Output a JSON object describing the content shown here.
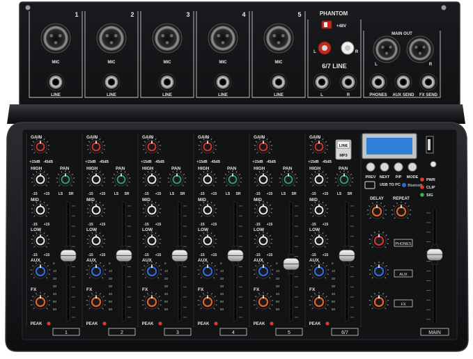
{
  "device": {
    "top_panel": {
      "channel_numbers": [
        "1",
        "2",
        "3",
        "4",
        "5"
      ],
      "mic_label": "MIC",
      "line_label": "LINE",
      "phantom": {
        "title": "PHANTOM",
        "voltage": "+48V"
      },
      "rca": {
        "left": "L",
        "right": "R",
        "title": "6/7 LINE"
      },
      "stereo_line": {
        "left": "L",
        "right": "R"
      },
      "main_out": {
        "title": "MAIN OUT",
        "left": "L",
        "right": "R"
      },
      "outputs": [
        "PHONES",
        "AUX SEND",
        "FX SEND"
      ]
    },
    "channel_strip": {
      "gain_label": "GAIN",
      "gain_range": [
        "+15dB",
        "-45dB"
      ],
      "high_label": "HIGH",
      "pan_label": "PAN",
      "pan_range": [
        "LS",
        "SR"
      ],
      "mid_label": "MID",
      "low_label": "LOW",
      "eq_range": [
        "-15",
        "+15"
      ],
      "aux_label": "AUX",
      "fx_label": "FX",
      "peak_label": "PEAK",
      "level_scale": [
        "0",
        "10",
        "20",
        "30",
        "40",
        "50",
        "60"
      ]
    },
    "channels": [
      {
        "name": "1",
        "fader_level": 0.55
      },
      {
        "name": "2",
        "fader_level": 0.55
      },
      {
        "name": "3",
        "fader_level": 0.55
      },
      {
        "name": "4",
        "fader_level": 0.55
      },
      {
        "name": "5",
        "fader_level": 0.48
      },
      {
        "name": "6/7",
        "fader_level": 0.55
      }
    ],
    "media_player": {
      "mode_labels": [
        "LINE",
        "MP3"
      ],
      "buttons": [
        "PREV",
        "NEXT",
        "P/P",
        "MODE"
      ],
      "usb_label": "USB\nTO PC",
      "bluetooth_label": "Bluetooth"
    },
    "indicators": [
      "PWR",
      "CLIP",
      "SIG"
    ],
    "master": {
      "delay_label": "DELAY",
      "repeat_label": "REPEAT",
      "phones_label": "PHONES",
      "aux_label": "AUX",
      "fx_label": "FX",
      "main_label": "MAIN",
      "main_fader_level": 0.6
    },
    "colors": {
      "gain_knob": "#d0312d",
      "pan_knob": "#2e9e6a",
      "aux_knob": "#2f6bd8",
      "fx_knob": "#e0642a",
      "eq_knob": "#e8e8e8",
      "peak_led": "#e23b2e",
      "panel": "#141517"
    }
  }
}
